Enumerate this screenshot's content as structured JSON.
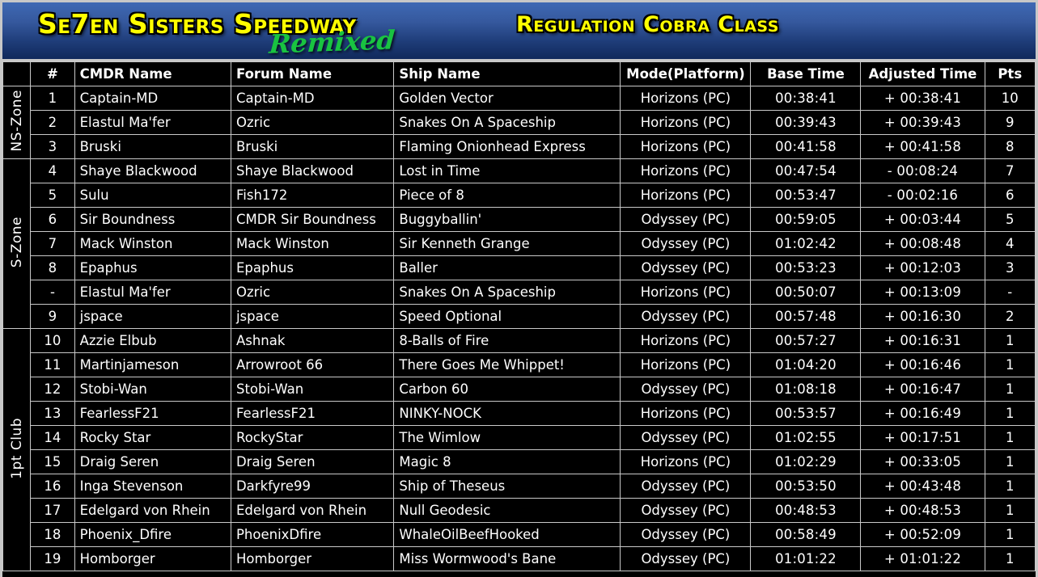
{
  "banner": {
    "title_main": "Se7en Sisters Speedway",
    "title_remix": "Remixed",
    "title_right": "Regulation Cobra Class",
    "colors": {
      "title_yellow": "#ffff00",
      "remix_green": "#19c341",
      "gradient_top": "#3f69b4",
      "gradient_bottom": "#10295b",
      "header_cyan": "#00eaf6",
      "dim_text": "#5a5a5a"
    }
  },
  "table": {
    "corner_icon": "diagonal-hatch",
    "columns": [
      "#",
      "CMDR Name",
      "Forum Name",
      "Ship Name",
      "Mode(Platform)",
      "Base Time",
      "Adjusted Time",
      "Pts"
    ],
    "zones": [
      {
        "label": "NS-Zone",
        "highlight": "base",
        "rows": [
          {
            "num": "1",
            "cmdr": "Captain-MD",
            "forum": "Captain-MD",
            "ship": "Golden Vector",
            "mode": "Horizons (PC)",
            "base": "00:38:41",
            "adj": "+ 00:38:41",
            "pts": "10"
          },
          {
            "num": "2",
            "cmdr": "Elastul Ma'fer",
            "forum": "Ozric",
            "ship": "Snakes On A Spaceship",
            "mode": "Horizons (PC)",
            "base": "00:39:43",
            "adj": "+ 00:39:43",
            "pts": "9"
          },
          {
            "num": "3",
            "cmdr": "Bruski",
            "forum": "Bruski",
            "ship": "Flaming Onionhead Express",
            "mode": "Horizons (PC)",
            "base": "00:41:58",
            "adj": "+ 00:41:58",
            "pts": "8"
          }
        ]
      },
      {
        "label": "S-Zone",
        "highlight": "adj",
        "rows": [
          {
            "num": "4",
            "cmdr": "Shaye Blackwood",
            "forum": "Shaye Blackwood",
            "ship": "Lost in Time",
            "mode": "Horizons (PC)",
            "base": "00:47:54",
            "adj": "-  00:08:24",
            "pts": "7"
          },
          {
            "num": "5",
            "cmdr": "Sulu",
            "forum": "Fish172",
            "ship": "Piece of 8",
            "mode": "Horizons (PC)",
            "base": "00:53:47",
            "adj": "-  00:02:16",
            "pts": "6"
          },
          {
            "num": "6",
            "cmdr": "Sir Boundness",
            "forum": "CMDR Sir Boundness",
            "ship": "Buggyballin'",
            "mode": "Odyssey (PC)",
            "base": "00:59:05",
            "adj": "+ 00:03:44",
            "pts": "5"
          },
          {
            "num": "7",
            "cmdr": "Mack Winston",
            "forum": "Mack Winston",
            "ship": "Sir Kenneth Grange",
            "mode": "Odyssey (PC)",
            "base": "01:02:42",
            "adj": "+ 00:08:48",
            "pts": "4"
          },
          {
            "num": "8",
            "cmdr": "Epaphus",
            "forum": "Epaphus",
            "ship": "Baller",
            "mode": "Odyssey (PC)",
            "base": "00:53:23",
            "adj": "+ 00:12:03",
            "pts": "3"
          },
          {
            "num": "-",
            "cmdr": "Elastul Ma'fer",
            "forum": "Ozric",
            "ship": "Snakes On A Spaceship",
            "mode": "Horizons (PC)",
            "base": "00:50:07",
            "adj": "+ 00:13:09",
            "pts": "-"
          },
          {
            "num": "9",
            "cmdr": "jspace",
            "forum": "jspace",
            "ship": "Speed Optional",
            "mode": "Odyssey (PC)",
            "base": "00:57:48",
            "adj": "+ 00:16:30",
            "pts": "2"
          }
        ]
      },
      {
        "label": "1pt Club",
        "highlight": "adj",
        "rows": [
          {
            "num": "10",
            "cmdr": "Azzie Elbub",
            "forum": "Ashnak",
            "ship": "8-Balls of Fire",
            "mode": "Horizons (PC)",
            "base": "00:57:27",
            "adj": "+ 00:16:31",
            "pts": "1"
          },
          {
            "num": "11",
            "cmdr": "Martinjameson",
            "forum": "Arrowroot 66",
            "ship": "There Goes Me Whippet!",
            "mode": "Horizons (PC)",
            "base": "01:04:20",
            "adj": "+ 00:16:46",
            "pts": "1"
          },
          {
            "num": "12",
            "cmdr": "Stobi-Wan",
            "forum": "Stobi-Wan",
            "ship": "Carbon 60",
            "mode": "Odyssey (PC)",
            "base": "01:08:18",
            "adj": "+ 00:16:47",
            "pts": "1"
          },
          {
            "num": "13",
            "cmdr": "FearlessF21",
            "forum": "FearlessF21",
            "ship": "NINKY-NOCK",
            "mode": "Horizons (PC)",
            "base": "00:53:57",
            "adj": "+ 00:16:49",
            "pts": "1"
          },
          {
            "num": "14",
            "cmdr": "Rocky Star",
            "forum": "RockyStar",
            "ship": "The Wimlow",
            "mode": "Odyssey (PC)",
            "base": "01:02:55",
            "adj": "+ 00:17:51",
            "pts": "1"
          },
          {
            "num": "15",
            "cmdr": "Draig Seren",
            "forum": "Draig Seren",
            "ship": "Magic 8",
            "mode": "Horizons (PC)",
            "base": "01:02:29",
            "adj": "+ 00:33:05",
            "pts": "1"
          },
          {
            "num": "16",
            "cmdr": "Inga Stevenson",
            "forum": "Darkfyre99",
            "ship": "Ship of Theseus",
            "mode": "Odyssey (PC)",
            "base": "00:53:50",
            "adj": "+ 00:43:48",
            "pts": "1"
          },
          {
            "num": "17",
            "cmdr": "Edelgard von Rhein",
            "forum": "Edelgard von Rhein",
            "ship": "Null Geodesic",
            "mode": "Odyssey (PC)",
            "base": "00:48:53",
            "adj": "+ 00:48:53",
            "pts": "1"
          },
          {
            "num": "18",
            "cmdr": "Phoenix_Dfire",
            "forum": "PhoenixDfire",
            "ship": "WhaleOilBeefHooked",
            "mode": "Odyssey (PC)",
            "base": "00:58:49",
            "adj": "+ 00:52:09",
            "pts": "1"
          },
          {
            "num": "19",
            "cmdr": "Homborger",
            "forum": "Homborger",
            "ship": "Miss Wormwood's Bane",
            "mode": "Odyssey (PC)",
            "base": "01:01:22",
            "adj": "+ 01:01:22",
            "pts": "1"
          }
        ]
      }
    ]
  }
}
